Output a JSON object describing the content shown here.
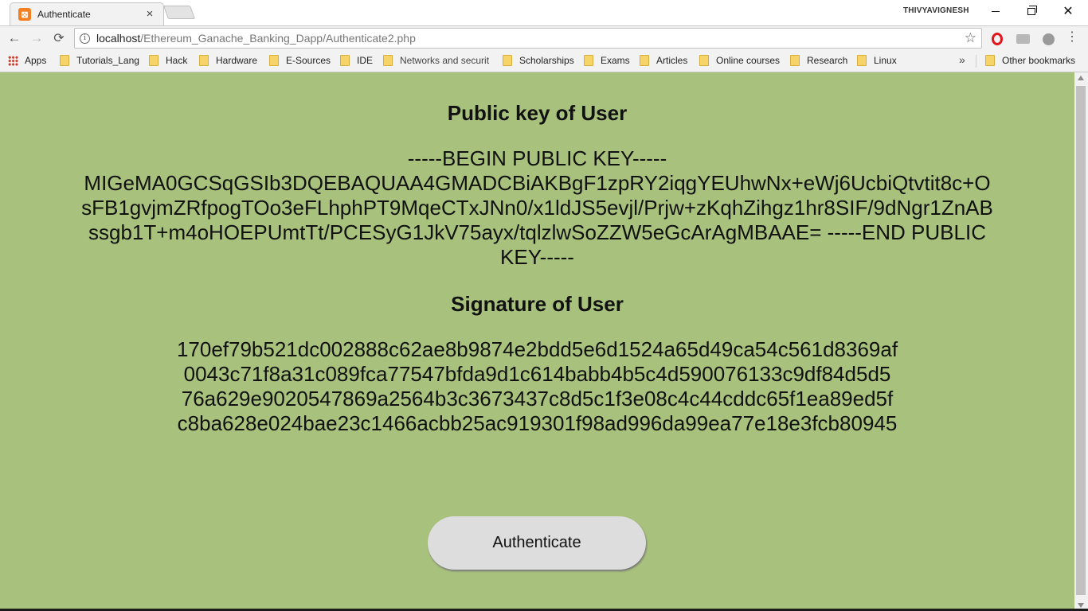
{
  "tab": {
    "title": "Authenticate",
    "close_glyph": "×",
    "favicon": "xampp-icon"
  },
  "window": {
    "user": "THIVYAVIGNESH",
    "close_glyph": "✕"
  },
  "toolbar": {
    "back_glyph": "←",
    "forward_glyph": "→",
    "reload_glyph": "⟳",
    "info_glyph": "i",
    "url_host": "localhost",
    "url_path": "/Ethereum_Ganache_Banking_Dapp/Authenticate2.php",
    "star_glyph": "☆",
    "menu_glyph": "⋮"
  },
  "bookmarks": {
    "apps_label": "Apps",
    "items": [
      "Tutorials_Lang",
      "Hack",
      "Hardware",
      "E-Sources",
      "IDE",
      "Networks and securit",
      "Scholarships",
      "Exams",
      "Articles",
      "Online courses",
      "Research",
      "Linux"
    ],
    "more_glyph": "»",
    "other_label": "Other bookmarks"
  },
  "page": {
    "background_color": "#a8c17c",
    "public_key_heading": "Public key of User",
    "public_key": "-----BEGIN PUBLIC KEY----- MIGeMA0GCSqGSIb3DQEBAQUAA4GMADCBiAKBgF1zpRY2iqgYEUhwNx+eWj6UcbiQtvtit8c+OsFB1gvjmZRfpogTOo3eFLhphPT9MqeCTxJNn0/x1ldJS5evjl/Prjw+zKqhZihgz1hr8SIF/9dNgr1ZnABssgb1T+m4oHOEPUmtTt/PCESyG1JkV75ayx/tqlzlwSoZZW5eGcArAgMBAAE= -----END PUBLIC KEY-----",
    "signature_heading": "Signature of User",
    "signature_lines": [
      "170ef79b521dc002888c62ae8b9874e2bdd5e6d1524a65d49ca54c561d8369af",
      "0043c71f8a31c089fca77547bfda9d1c614babb4b5c4d590076133c9df84d5d5",
      "76a629e9020547869a2564b3c3673437c8d5c1f3e08c4c44cddc65f1ea89ed5f",
      "c8ba628e024bae23c1466acbb25ac919301f98ad996da99ea77e18e3fcb80945"
    ],
    "authenticate_button": "Authenticate"
  }
}
